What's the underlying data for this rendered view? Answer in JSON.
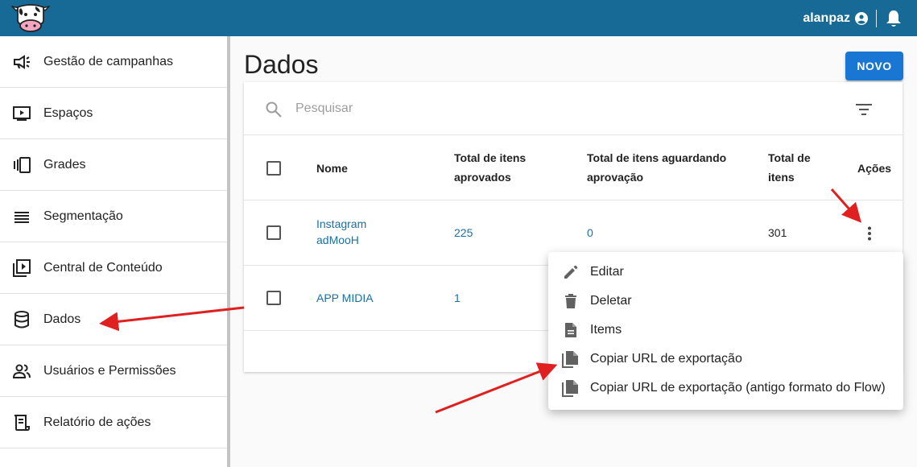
{
  "header": {
    "username": "alanpaz",
    "brand_color": "#176a96"
  },
  "sidebar": {
    "items": [
      {
        "label": "Gestão de campanhas",
        "icon": "megaphone-icon"
      },
      {
        "label": "Espaços",
        "icon": "play-screen-icon"
      },
      {
        "label": "Grades",
        "icon": "carousel-icon"
      },
      {
        "label": "Segmentação",
        "icon": "list-icon"
      },
      {
        "label": "Central de Conteúdo",
        "icon": "video-library-icon"
      },
      {
        "label": "Dados",
        "icon": "database-icon"
      },
      {
        "label": "Usuários e Permissões",
        "icon": "people-icon"
      },
      {
        "label": "Relatório de ações",
        "icon": "report-icon"
      }
    ]
  },
  "main": {
    "title": "Dados",
    "new_button": "NOVO",
    "accent_color": "#1976d2",
    "search": {
      "placeholder": "Pesquisar"
    },
    "table": {
      "headers": {
        "name": "Nome",
        "approved_1": "Total de itens",
        "approved_2": "aprovados",
        "pending_1": "Total de itens aguardando",
        "pending_2": "aprovação",
        "total_1": "Total de",
        "total_2": "itens",
        "actions": "Ações"
      },
      "rows": [
        {
          "name_1": "Instagram",
          "name_2": "adMooH",
          "approved": "225",
          "pending": "0",
          "total": "301"
        },
        {
          "name_1": "APP MIDIA",
          "approved": "1"
        }
      ]
    },
    "actions_menu": {
      "items": [
        {
          "label": "Editar",
          "icon": "pencil-icon"
        },
        {
          "label": "Deletar",
          "icon": "trash-icon"
        },
        {
          "label": "Items",
          "icon": "document-icon"
        },
        {
          "label": "Copiar URL de exportação",
          "icon": "copy-file-icon"
        },
        {
          "label": "Copiar URL de exportação (antigo formato do Flow)",
          "icon": "copy-file-icon"
        }
      ]
    }
  },
  "annotation_color": "#e02020"
}
